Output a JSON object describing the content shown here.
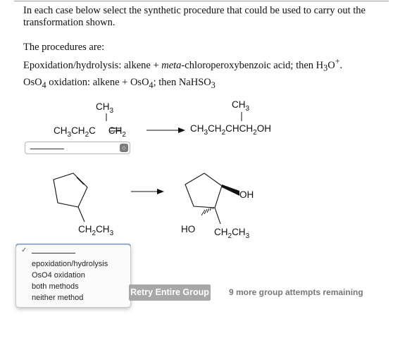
{
  "question": {
    "intro": "In each case below select the synthetic procedure that could be used to carry out the transformation shown.",
    "procedures_heading": "The procedures are:",
    "epox_label": "Epoxidation/hydrolysis: alkene + ",
    "epox_meta": "meta",
    "epox_reagent": "-chloroperoxybenzoic acid; then H",
    "epox_h3o_sub": "3",
    "epox_o": "O",
    "epox_sup": "+",
    "epox_end": ".",
    "oso4_os": "OsO",
    "oso4_sub": "4",
    "oso4_mid": " oxidation: alkene + OsO",
    "oso4_sub2": "4",
    "oso4_then": "; then NaHSO",
    "oso4_sub3": "3"
  },
  "reaction1": {
    "reactant_ch3": "CH",
    "reactant_ch3_sub": "3",
    "reactant_main_parts": [
      "CH",
      "3",
      "CH",
      "2",
      "C",
      "CH",
      "2"
    ],
    "product_ch3": "CH",
    "product_ch3_sub": "3",
    "product_main_parts": [
      "CH",
      "3",
      "CH",
      "2",
      "CHCH",
      "2",
      "OH"
    ]
  },
  "reaction2": {
    "reactant_sub_label": "CH",
    "reactant_sub_sub": "2",
    "reactant_sub_label2": "CH",
    "reactant_sub_sub2": "3",
    "product_oh": "OH",
    "product_ho": "HO",
    "product_ethyl": "CH",
    "product_ethyl_sub": "2",
    "product_ethyl2": "CH",
    "product_ethyl_sub2": "3"
  },
  "select1": {
    "value": "",
    "icon": "stepper-icon"
  },
  "dropdown": {
    "options": [
      "epoxidation/hydrolysis",
      "OsO4 oxidation",
      "both methods",
      "neither method"
    ],
    "selected_marker": "✓"
  },
  "actions": {
    "retry_label": "Retry Entire Group",
    "remaining_label": "9 more group attempts remaining"
  },
  "colors": {
    "accent": "#6ea0dc",
    "button": "#a7a7a7",
    "muted_text": "#777777"
  }
}
